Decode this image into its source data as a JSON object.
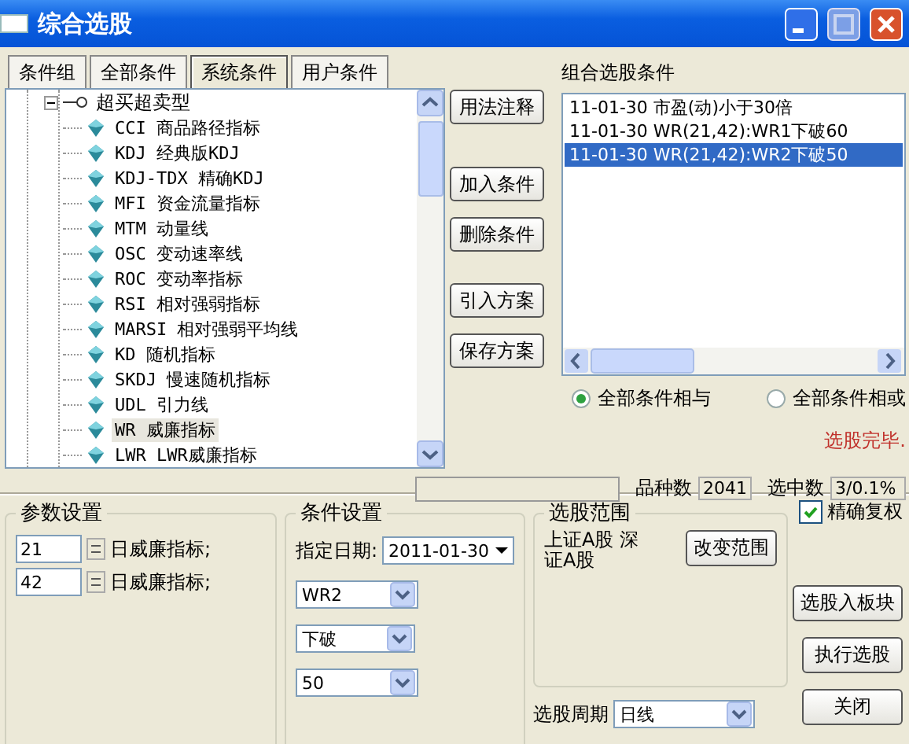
{
  "window": {
    "title": "综合选股"
  },
  "tabs": [
    {
      "label": "条件组",
      "selected": false
    },
    {
      "label": "全部条件",
      "selected": false
    },
    {
      "label": "系统条件",
      "selected": true
    },
    {
      "label": "用户条件",
      "selected": false
    }
  ],
  "tree": {
    "label": "超买超卖型",
    "expanded": true,
    "children": [
      {
        "label": "CCI 商品路径指标",
        "selected": false
      },
      {
        "label": "KDJ 经典版KDJ",
        "selected": false
      },
      {
        "label": "KDJ-TDX 精确KDJ",
        "selected": false
      },
      {
        "label": "MFI 资金流量指标",
        "selected": false
      },
      {
        "label": "MTM 动量线",
        "selected": false
      },
      {
        "label": "OSC 变动速率线",
        "selected": false
      },
      {
        "label": "ROC 变动率指标",
        "selected": false
      },
      {
        "label": "RSI 相对强弱指标",
        "selected": false
      },
      {
        "label": "MARSI 相对强弱平均线",
        "selected": false
      },
      {
        "label": "KD 随机指标",
        "selected": false
      },
      {
        "label": "SKDJ 慢速随机指标",
        "selected": false
      },
      {
        "label": "UDL 引力线",
        "selected": false
      },
      {
        "label": "WR 威廉指标",
        "selected": true
      },
      {
        "label": "LWR LWR威廉指标",
        "selected": false
      }
    ]
  },
  "side_buttons": [
    "用法注释",
    "加入条件",
    "删除条件",
    "引入方案",
    "保存方案"
  ],
  "conditions": {
    "title": "组合选股条件",
    "items": [
      {
        "text": "11-01-30 市盈(动)小于30倍",
        "selected": false
      },
      {
        "text": "11-01-30 WR(21,42):WR1下破60",
        "selected": false
      },
      {
        "text": "11-01-30 WR(21,42):WR2下破50",
        "selected": true
      }
    ]
  },
  "logic": [
    {
      "label": "全部条件相与",
      "selected": true
    },
    {
      "label": "全部条件相或",
      "selected": false
    }
  ],
  "status_message": "选股完毕.",
  "stats": {
    "count_label": "品种数",
    "count": "2041",
    "selected_label": "选中数",
    "selected": "3/0.1%"
  },
  "params": {
    "title": "参数设置",
    "rows": [
      {
        "value": "21",
        "label": "日威廉指标;"
      },
      {
        "value": "42",
        "label": "日威廉指标;"
      }
    ]
  },
  "condition_setup": {
    "title": "条件设置",
    "date_label": "指定日期:",
    "date": "2011-01-30",
    "line": "WR2",
    "operator": "下破",
    "threshold": "50"
  },
  "range": {
    "title": "选股范围",
    "text": "上证A股 深证A股",
    "button": "改变范围"
  },
  "precise": {
    "label": "精确复权",
    "checked": true
  },
  "action_buttons": [
    "选股入板块",
    "执行选股",
    "关闭"
  ],
  "period": {
    "label": "选股周期",
    "value": "日线"
  }
}
